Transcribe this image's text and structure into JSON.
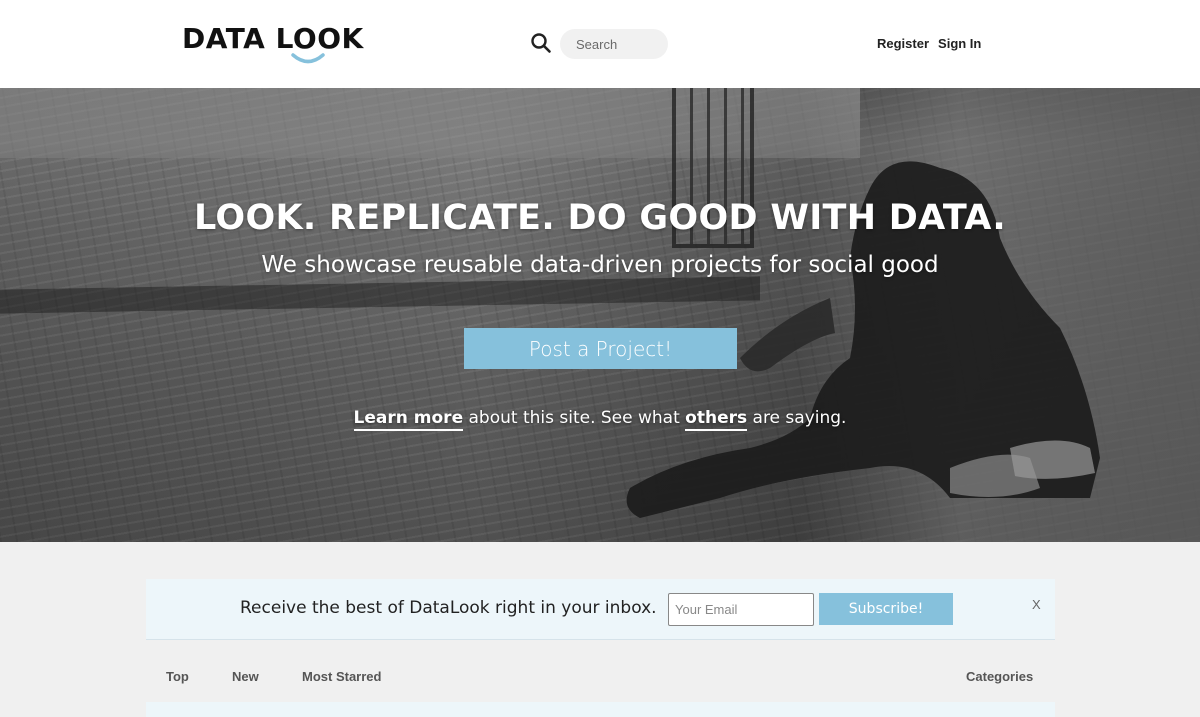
{
  "header": {
    "logo_text": "DATA LOOK",
    "search_placeholder": "Search",
    "nav": [
      {
        "label": "Register"
      },
      {
        "label": "Sign In"
      }
    ],
    "icons": {
      "search": "search-icon",
      "logo_smile": "smile-icon"
    }
  },
  "hero": {
    "title": "LOOK. REPLICATE. DO GOOD WITH DATA.",
    "subtitle": "We showcase reusable data-driven projects for social good",
    "cta_label": "Post a Project!",
    "learn_more": {
      "link1": "Learn more",
      "text1": " about this site. See what ",
      "link2": "others",
      "text2": " are saying."
    }
  },
  "subscribe": {
    "text": "Receive the best of DataLook right in your inbox.",
    "email_placeholder": "Your Email",
    "button_label": "Subscribe!",
    "close_label": "X"
  },
  "tabs": {
    "top": "Top",
    "new": "New",
    "most_starred": "Most Starred",
    "categories": "Categories"
  },
  "colors": {
    "accent": "#86c1dc",
    "subscribe_bg": "#edf6fa",
    "page_bg": "#f0f0f0",
    "logo_smile": "#86c1dc"
  }
}
